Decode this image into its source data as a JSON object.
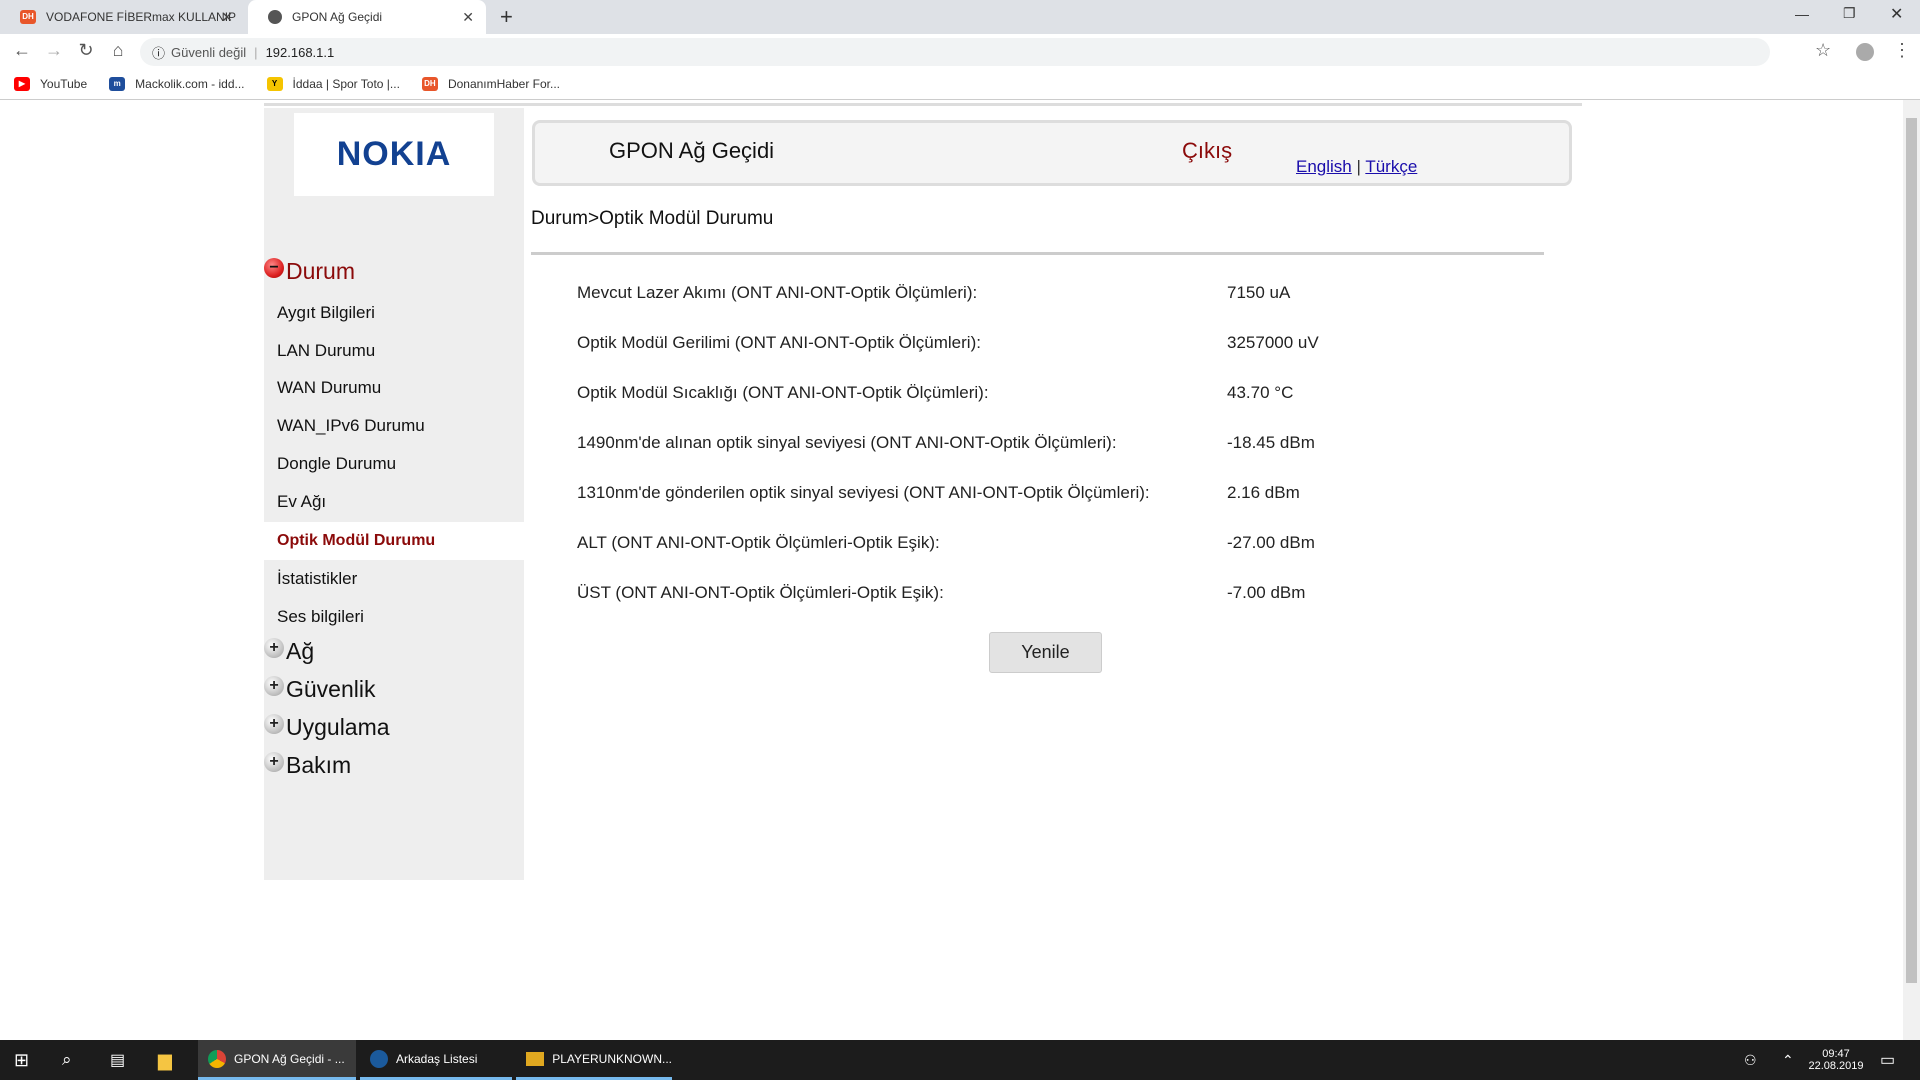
{
  "browser": {
    "tabs": [
      {
        "title": "VODAFONE FİBERmax KULLANIP",
        "icon": "donanimhaber-icon"
      },
      {
        "title": "GPON Ağ Geçidi",
        "icon": "globe-icon",
        "active": true
      }
    ],
    "security_label": "Güvenli değil",
    "url": "192.168.1.1",
    "bookmarks": [
      {
        "label": "YouTube",
        "color": "#ff0000"
      },
      {
        "label": "Mackolik.com - idd...",
        "color": "#1f4e9c"
      },
      {
        "label": "İddaa | Spor Toto |...",
        "color": "#f5c400"
      },
      {
        "label": "DonanımHaber For...",
        "color": "#e8562a"
      }
    ]
  },
  "logo": "NOKIA",
  "header": {
    "title": "GPON Ağ Geçidi",
    "logout": "Çıkış",
    "lang_en": "English",
    "lang_sep": "|",
    "lang_tr": "Türkçe"
  },
  "sidebar": {
    "group_open": "Durum",
    "items": [
      "Aygıt Bilgileri",
      "LAN Durumu",
      "WAN Durumu",
      "WAN_IPv6 Durumu",
      "Dongle Durumu",
      "Ev Ağı",
      "Optik Modül Durumu",
      "İstatistikler",
      "Ses bilgileri"
    ],
    "selected": "Optik Modül Durumu",
    "groups": [
      "Ağ",
      "Güvenlik",
      "Uygulama",
      "Bakım"
    ]
  },
  "breadcrumb": "Durum>Optik Modül Durumu",
  "rows": [
    {
      "label": "Mevcut Lazer Akımı (ONT ANI-ONT-Optik Ölçümleri):",
      "value": "7150 uA"
    },
    {
      "label": "Optik Modül Gerilimi (ONT ANI-ONT-Optik Ölçümleri):",
      "value": "3257000 uV"
    },
    {
      "label": "Optik Modül Sıcaklığı (ONT ANI-ONT-Optik Ölçümleri):",
      "value": "43.70 °C"
    },
    {
      "label": "1490nm'de alınan optik sinyal seviyesi (ONT ANI-ONT-Optik Ölçümleri):",
      "value": "-18.45 dBm"
    },
    {
      "label": "1310nm'de gönderilen optik sinyal seviyesi (ONT ANI-ONT-Optik Ölçümleri):",
      "value": "2.16 dBm"
    },
    {
      "label": "ALT (ONT ANI-ONT-Optik Ölçümleri-Optik Eşik):",
      "value": "-27.00 dBm"
    },
    {
      "label": "ÜST (ONT ANI-ONT-Optik Ölçümleri-Optik Eşik):",
      "value": "-7.00 dBm"
    }
  ],
  "refresh_label": "Yenile",
  "taskbar": {
    "apps": [
      "GPON Ağ Geçidi - ...",
      "Arkadaş Listesi",
      "PLAYERUNKNOWN..."
    ],
    "time": "09:47",
    "date": "22.08.2019"
  },
  "colors": {
    "accent": "#8b0a0a",
    "link": "#1a0dab",
    "nokia": "#124191"
  }
}
